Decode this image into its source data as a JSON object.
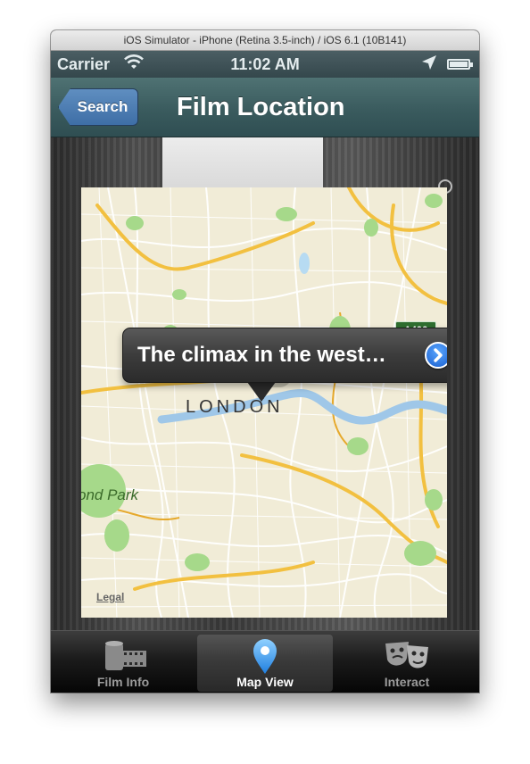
{
  "window": {
    "title": "iOS Simulator - iPhone (Retina 3.5-inch) / iOS 6.1 (10B141)"
  },
  "status_bar": {
    "carrier": "Carrier",
    "time": "11:02 AM",
    "wifi_icon": "wifi-icon",
    "location_icon": "location-arrow-icon",
    "battery_icon": "battery-icon"
  },
  "nav_bar": {
    "back_label": "Search",
    "title": "Film Location"
  },
  "map": {
    "callout_text": "The climax in the west…",
    "city_label": "LONDON",
    "park_label": "ond Park",
    "legal_label": "Legal",
    "road_label": "A406",
    "pin_color": "#7d22c9"
  },
  "tab_bar": {
    "tabs": [
      {
        "label": "Film Info",
        "icon": "film-reel-icon",
        "selected": false
      },
      {
        "label": "Map View",
        "icon": "map-pin-icon",
        "selected": true
      },
      {
        "label": "Interact",
        "icon": "theater-masks-icon",
        "selected": false
      }
    ]
  },
  "colors": {
    "nav_bar": "#3a5b5e",
    "back_button": "#4a7bb3",
    "disclosure": "#2a7ae8"
  }
}
